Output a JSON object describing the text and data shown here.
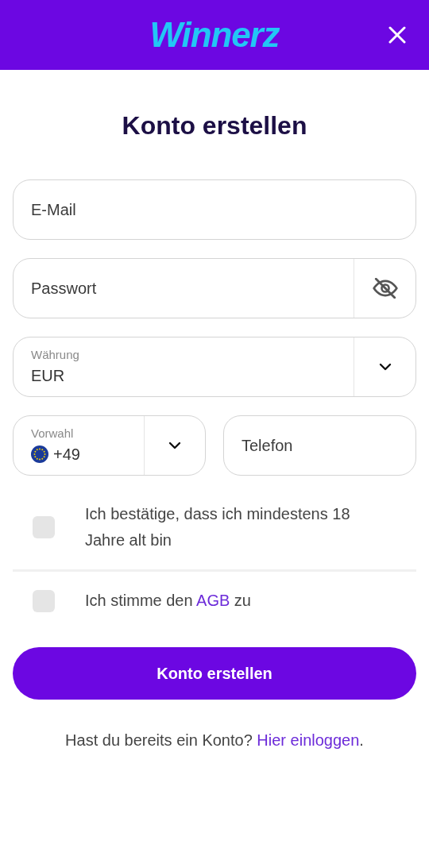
{
  "header": {
    "logo": "Winnerz"
  },
  "title": "Konto erstellen",
  "fields": [
    {
      "kind": "text",
      "placeholder": "E-Mail"
    },
    {
      "kind": "password",
      "placeholder": "Passwort"
    },
    {
      "kind": "select",
      "label": "Währung",
      "value": "EUR"
    }
  ],
  "phone": {
    "prefix": {
      "label": "Vorwahl",
      "value": "+49"
    },
    "number": {
      "placeholder": "Telefon"
    }
  },
  "consents": [
    {
      "checked": false,
      "before": "Ich bestätige, dass ich mindestens 18 Jahre alt bin"
    },
    {
      "checked": false,
      "before": "Ich stimme den ",
      "link": "AGB",
      "after": " zu"
    }
  ],
  "submit": "Konto erstellen",
  "login": {
    "text": "Hast du bereits ein Konto? ",
    "link": "Hier einloggen",
    "after": "."
  }
}
